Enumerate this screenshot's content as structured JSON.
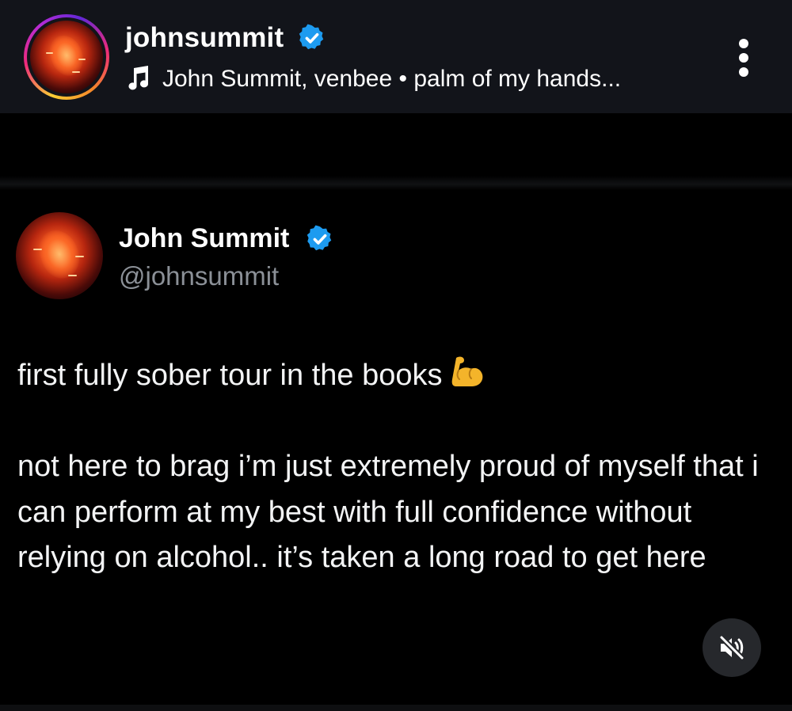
{
  "header": {
    "username": "johnsummit",
    "music_label": "John Summit, venbee • palm of my hands..."
  },
  "tweet": {
    "display_name": "John Summit",
    "handle": "@johnsummit",
    "text_line_1": "first fully sober tour in the books",
    "text_paragraph_2": "not here to brag i’m just extremely proud of myself that i can perform at my best with full confidence without relying on alcohol.. it’s taken a long road to get here"
  },
  "icons": {
    "verified": "verified-badge-icon",
    "music": "music-note-icon",
    "more": "more-vertical-icon",
    "mute": "speaker-muted-icon",
    "emoji": "flexed-biceps-emoji"
  },
  "colors": {
    "verified_blue": "#1d9bf0",
    "background": "#000000",
    "header_bg": "#12141a",
    "handle_gray": "#8b9097"
  }
}
